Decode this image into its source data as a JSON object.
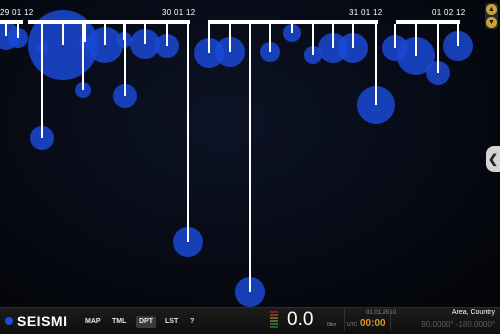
{
  "app": {
    "name": "SEISMI"
  },
  "dates": [
    "29 01 12",
    "30 01 12",
    "31 01 12",
    "01 02 12"
  ],
  "nav": {
    "tabs": [
      "MAP",
      "TML",
      "DPT",
      "LST",
      "?"
    ],
    "active": "DPT"
  },
  "readout": {
    "magnitude": "0.0",
    "magnitude_unit": "0km",
    "date": "01.01.2010",
    "utc_label": "UTC",
    "time": "00:00",
    "area": "Area, Country",
    "coords": "90.0000°  -180.0000°"
  },
  "controls": {
    "top_icons": [
      "up-arrow-icon",
      "down-arrow-icon"
    ],
    "side_tab_icon": "chevron-left-icon",
    "side_tab_glyph": "❮"
  },
  "colors": {
    "bubble": "#1a49d4",
    "line": "#ffffff",
    "accent": "#d69a1e",
    "logo_dot": "#1c4ed6"
  }
}
